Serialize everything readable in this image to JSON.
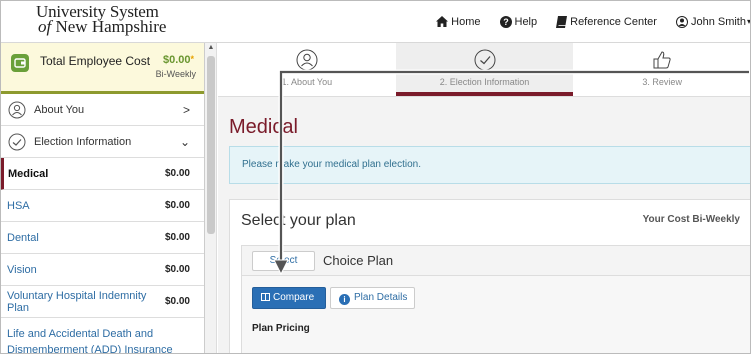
{
  "header": {
    "logo_line1": "University System",
    "logo_of": "of",
    "logo_line2": "New Hampshire",
    "nav": {
      "home": "Home",
      "help": "Help",
      "reference": "Reference Center",
      "user": "John Smith"
    }
  },
  "sidebar": {
    "cost": {
      "label": "Total Employee Cost",
      "amount": "$0.00",
      "star": "*",
      "frequency": "Bi-Weekly",
      "accent": "#8d9a2e"
    },
    "sections": [
      {
        "label": "About You",
        "chevron": ">"
      },
      {
        "label": "Election Information",
        "chevron": "⌄"
      }
    ],
    "items": [
      {
        "label": "Medical",
        "amount": "$0.00"
      },
      {
        "label": "HSA",
        "amount": "$0.00"
      },
      {
        "label": "Dental",
        "amount": "$0.00"
      },
      {
        "label": "Vision",
        "amount": "$0.00"
      },
      {
        "label": "Voluntary Hospital Indemnity Plan",
        "amount": "$0.00"
      },
      {
        "label": "Life and Accidental Death and Dismemberment (ADD) Insurance",
        "amount": ""
      }
    ]
  },
  "steps": [
    {
      "label": "1. About You",
      "icon": "person-icon"
    },
    {
      "label": "2. Election Information",
      "icon": "check-circle-icon"
    },
    {
      "label": "3. Review",
      "icon": "thumbs-up-icon"
    }
  ],
  "main": {
    "title": "Medical",
    "info": "Please make your medical plan election.",
    "panel_title": "Select your plan",
    "panel_right": "Your Cost Bi-Weekly",
    "plan": {
      "select_label": "Select",
      "name": "Choice Plan",
      "compare_label": "Compare",
      "details_label": "Plan Details",
      "pricing_label": "Plan Pricing"
    }
  },
  "colors": {
    "brand": "#7a1b2a",
    "link": "#2e6da4",
    "primary_button": "#2a6fb5",
    "info_bg": "#e6f4f8"
  }
}
